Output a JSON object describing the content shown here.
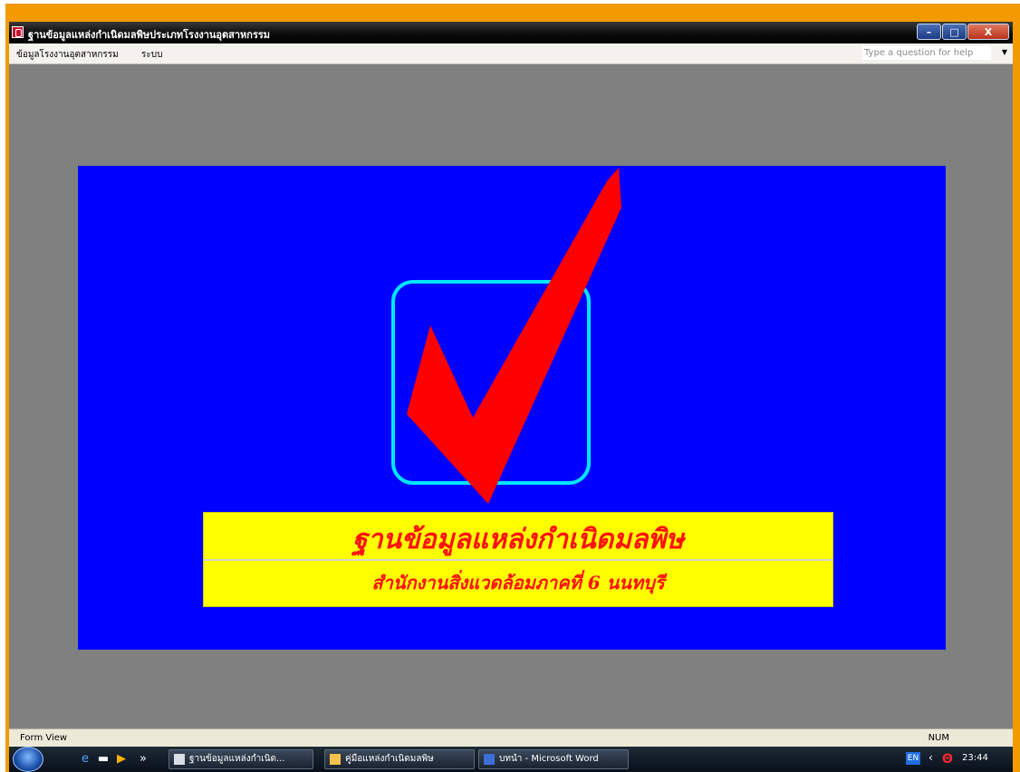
{
  "window": {
    "title": "ฐานข้อมูลแหล่งกำเนิดมลพิษประเภทโรงงานอุตสาหกรรม",
    "buttons": {
      "minimize": "–",
      "maximize": "□",
      "close": "X"
    }
  },
  "menubar": {
    "items": [
      {
        "label": "ข้อมูลโรงงานอุตสาหกรรม"
      },
      {
        "label": "ระบบ"
      }
    ],
    "help_placeholder": "Type a question for help"
  },
  "splash": {
    "title": "ฐานข้อมูลแหล่งกำเนิดมลพิษ",
    "subtitle": "สำนักงานสิ่งแวดล้อมภาคที่ 6 นนทบุรี",
    "colors": {
      "background": "#0000ff",
      "box_border": "#00e5ff",
      "check": "#ff0000",
      "panel": "#ffff00",
      "text": "#ff1010"
    }
  },
  "statusbar": {
    "left": "Form View",
    "right": "NUM"
  },
  "taskbar": {
    "quick_launch": [
      "ie-icon",
      "desktop-icon",
      "media-icon"
    ],
    "more": "»",
    "buttons": [
      {
        "label": "ฐานข้อมูลแหล่งกำเนิด..."
      },
      {
        "label": "คู่มือแหล่งกำเนิดมลพิษ"
      },
      {
        "label": "บทนำ - Microsoft Word"
      }
    ],
    "language": "EN",
    "clock": "23:44"
  }
}
